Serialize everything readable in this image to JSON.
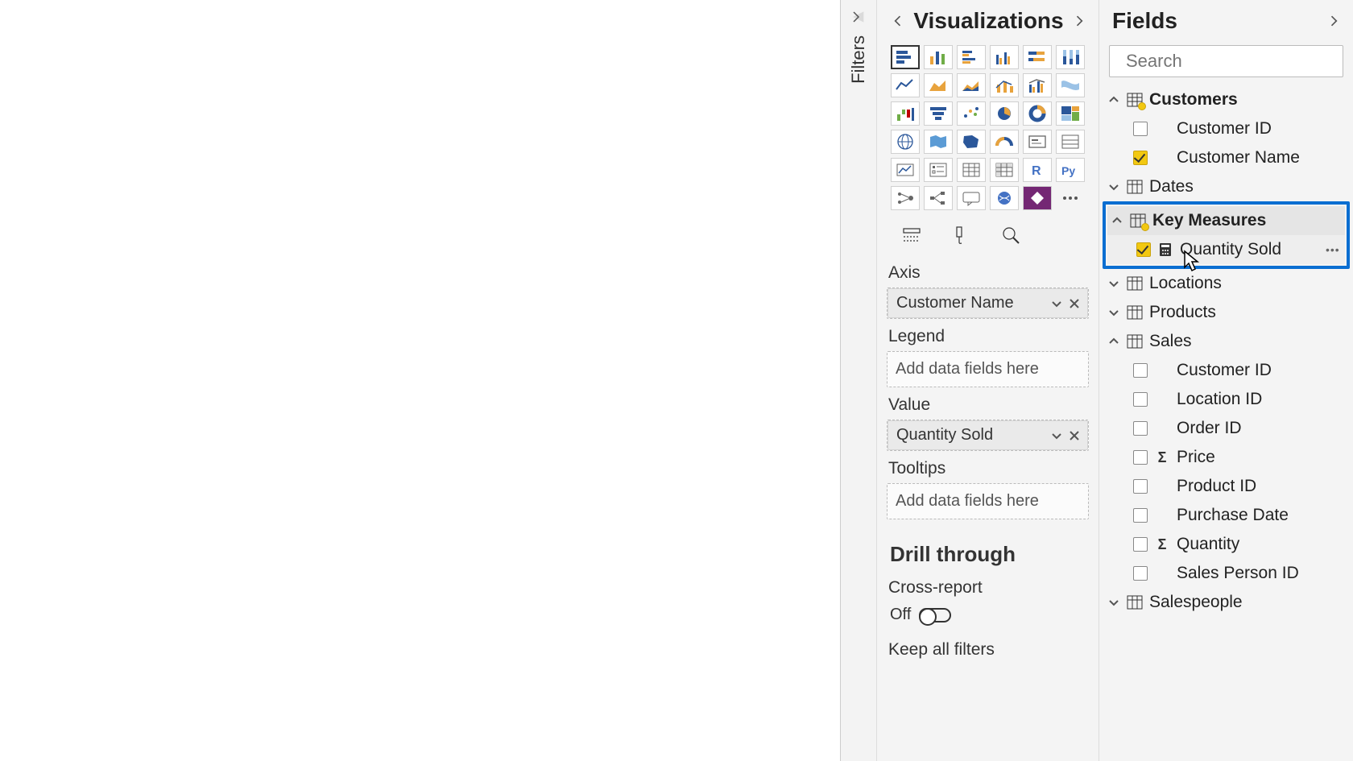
{
  "filters": {
    "label": "Filters"
  },
  "viz": {
    "title": "Visualizations",
    "wells": {
      "axis": {
        "label": "Axis",
        "item": "Customer Name"
      },
      "legend": {
        "label": "Legend",
        "placeholder": "Add data fields here"
      },
      "value": {
        "label": "Value",
        "item": "Quantity Sold"
      },
      "tooltips": {
        "label": "Tooltips",
        "placeholder": "Add data fields here"
      }
    },
    "drill": {
      "title": "Drill through",
      "cross_label": "Cross-report",
      "off": "Off",
      "keep": "Keep all filters"
    }
  },
  "fields": {
    "title": "Fields",
    "search_placeholder": "Search",
    "tables": {
      "customers": {
        "name": "Customers",
        "f0": "Customer ID",
        "f1": "Customer Name"
      },
      "dates": {
        "name": "Dates"
      },
      "key_measures": {
        "name": "Key Measures",
        "f0": "Quantity Sold"
      },
      "locations": {
        "name": "Locations"
      },
      "products": {
        "name": "Products"
      },
      "sales": {
        "name": "Sales",
        "f0": "Customer ID",
        "f1": "Location ID",
        "f2": "Order ID",
        "f3": "Price",
        "f4": "Product ID",
        "f5": "Purchase Date",
        "f6": "Quantity",
        "f7": "Sales Person ID"
      },
      "salespeople": {
        "name": "Salespeople"
      }
    }
  }
}
